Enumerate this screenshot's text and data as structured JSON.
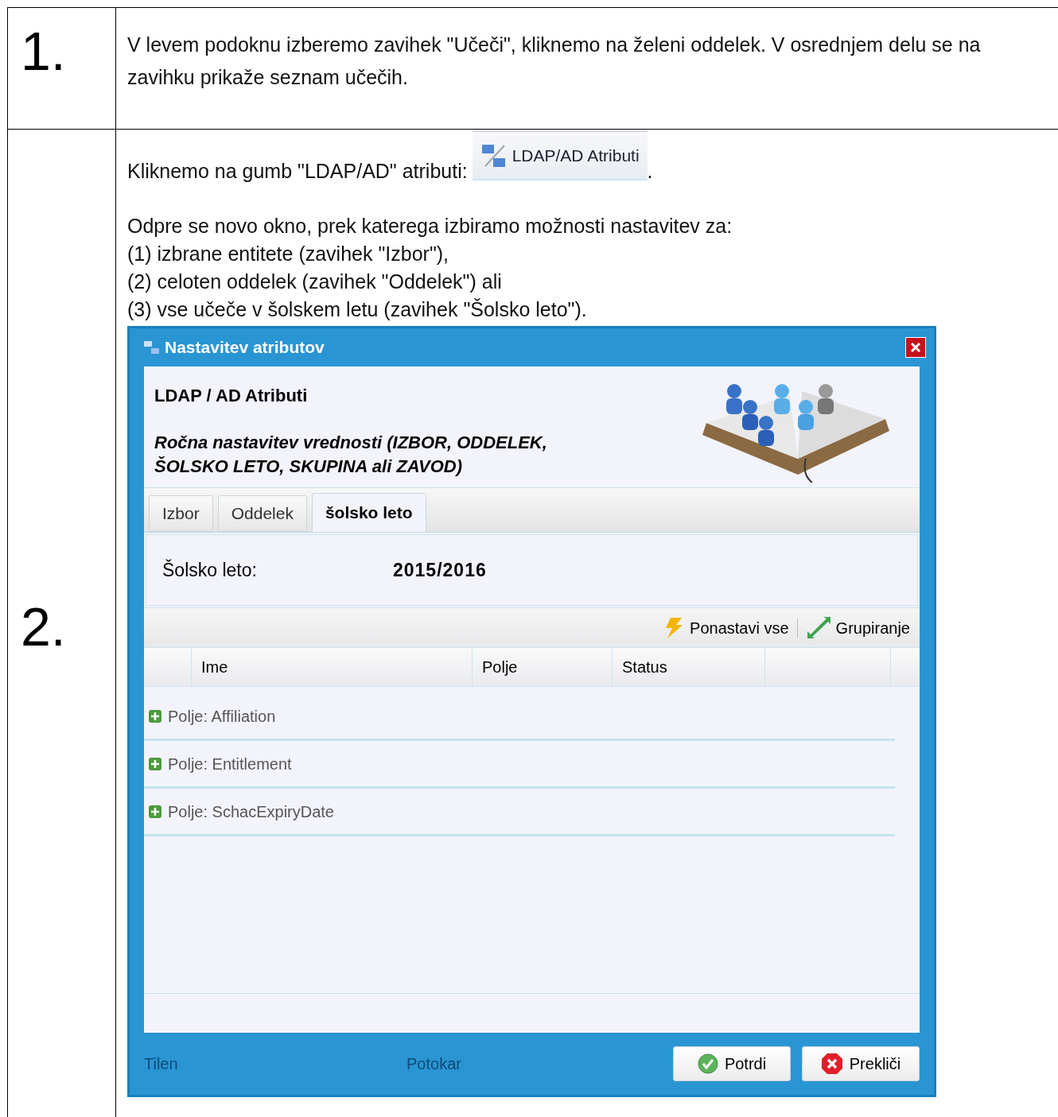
{
  "steps": [
    {
      "number": "1.",
      "paragraphs": [
        "V levem podoknu izberemo zavihek \"Učeči\", kliknemo na želeni oddelek. V osrednjem delu se na zavihku prikaže seznam učečih."
      ]
    },
    {
      "number": "2.",
      "intro": "Kliknemo na gumb \"LDAP/AD\" atributi:",
      "inline_button": "LDAP/AD Atributi",
      "intro_end": ".",
      "lines": [
        "Odpre se novo okno, prek katerega izbiramo možnosti nastavitev za:",
        "(1) izbrane entitete (zavihek \"Izbor\"),",
        "(2) celoten oddelek (zavihek \"Oddelek\") ali",
        "(3) vse učeče v šolskem letu (zavihek \"Šolsko leto\")."
      ]
    }
  ],
  "dialog": {
    "title": "Nastavitev atributov",
    "heading": "LDAP / AD Atributi",
    "subheading": "Ročna nastavitev vrednosti (IZBOR, ODDELEK, ŠOLSKO LETO, SKUPINA ali ZAVOD)",
    "tabs": [
      {
        "label": "Izbor",
        "selected": false
      },
      {
        "label": "Oddelek",
        "selected": false
      },
      {
        "label": "šolsko leto",
        "selected": true
      }
    ],
    "field": {
      "label": "Šolsko leto:",
      "value": "2015/2016"
    },
    "toolbar": [
      "Ponastavi vse",
      "Grupiranje"
    ],
    "columns": [
      "Ime",
      "Polje",
      "Status"
    ],
    "groups": [
      "Polje: Affiliation",
      "Polje: Entitlement",
      "Polje: SchacExpiryDate"
    ],
    "background_texts": [
      "Tilen",
      "Potokar"
    ],
    "buttons": [
      {
        "label": "Potrdi",
        "kind": "confirm"
      },
      {
        "label": "Prekliči",
        "kind": "cancel"
      }
    ]
  }
}
